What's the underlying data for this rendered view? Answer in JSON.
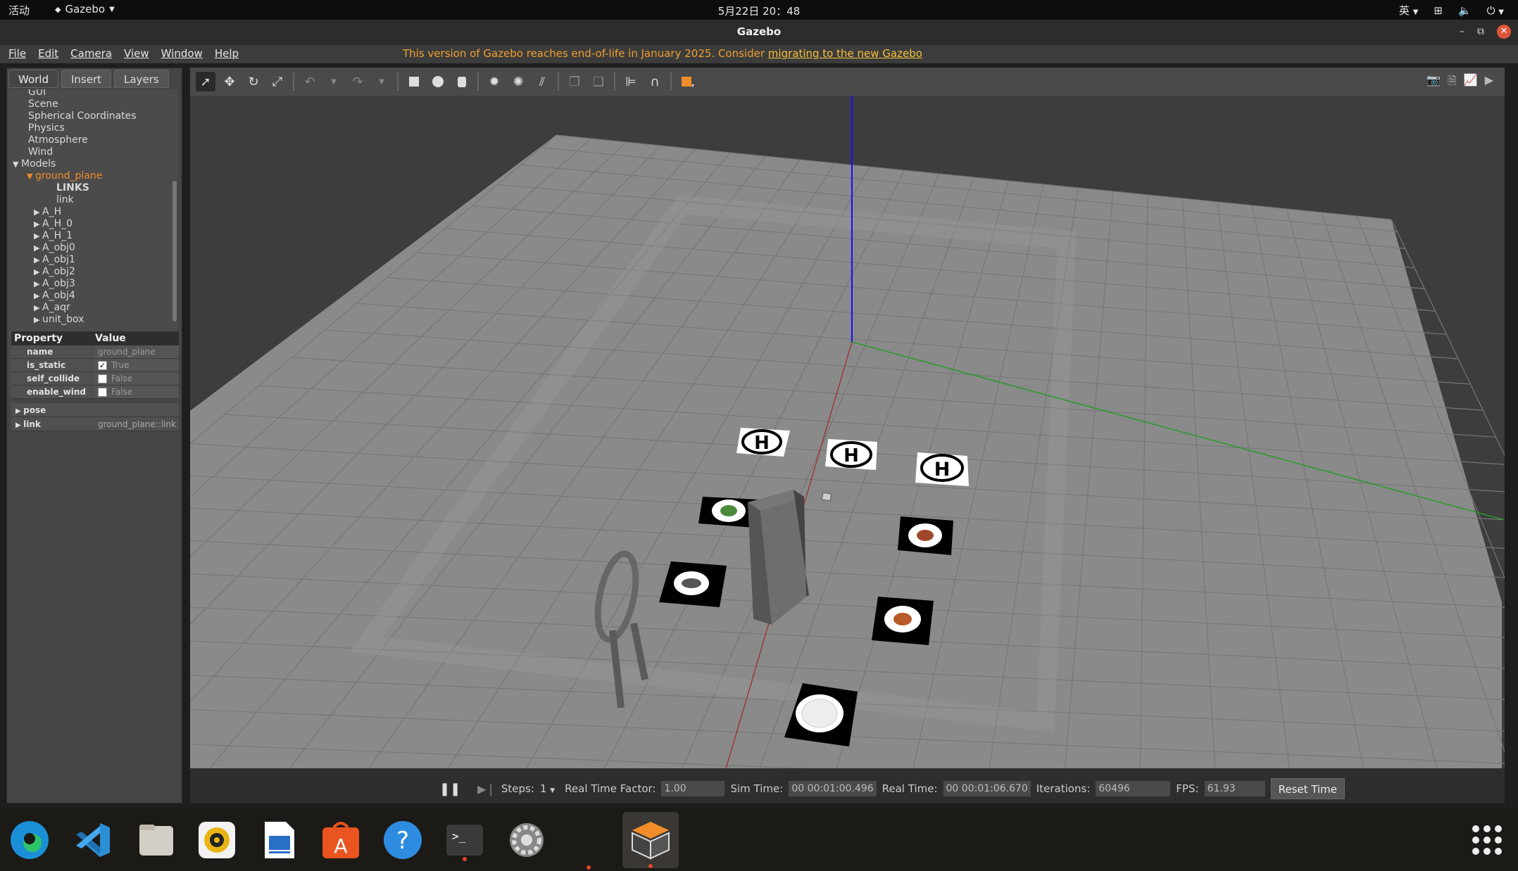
{
  "topbar": {
    "activities": "活动",
    "app_name": "Gazebo",
    "clock": "5月22日 20：48",
    "ime": "英"
  },
  "window": {
    "title": "Gazebo"
  },
  "menu": {
    "items": [
      "File",
      "Edit",
      "Camera",
      "View",
      "Window",
      "Help"
    ]
  },
  "notice": {
    "text": "This version of Gazebo reaches end-of-life in January 2025. Consider ",
    "link": "migrating to the new Gazebo"
  },
  "left_panel": {
    "tabs": [
      "World",
      "Insert",
      "Layers"
    ],
    "tree": {
      "top_items": [
        "GUI",
        "Scene",
        "Spherical Coordinates",
        "Physics",
        "Atmosphere",
        "Wind"
      ],
      "models_label": "Models",
      "selected": "ground_plane",
      "links_label": "LINKS",
      "link_label": "link",
      "models": [
        "A_H",
        "A_H_0",
        "A_H_1",
        "A_obj0",
        "A_obj1",
        "A_obj2",
        "A_obj3",
        "A_obj4",
        "A_aqr",
        "unit_box"
      ]
    },
    "properties": {
      "header_property": "Property",
      "header_value": "Value",
      "rows": [
        {
          "key": "name",
          "value": "ground_plane"
        },
        {
          "key": "is_static",
          "value": "True",
          "checked": true
        },
        {
          "key": "self_collide",
          "value": "False",
          "checked": false
        },
        {
          "key": "enable_wind",
          "value": "False",
          "checked": false
        }
      ],
      "pose_label": "pose",
      "link_label": "link",
      "link_value": "ground_plane::link"
    }
  },
  "status": {
    "steps_label": "Steps:",
    "steps_value": "1",
    "rtf_label": "Real Time Factor:",
    "rtf_value": "1.00",
    "sim_time_label": "Sim Time:",
    "sim_time_value": "00 00:01:00.496",
    "real_time_label": "Real Time:",
    "real_time_value": "00 00:01:06.670",
    "iterations_label": "Iterations:",
    "iterations_value": "60496",
    "fps_label": "FPS:",
    "fps_value": "61.93",
    "reset_label": "Reset Time"
  },
  "scene": {
    "h_marker_letter": "H"
  },
  "colors": {
    "accent": "#f08c2a",
    "eol": "#f0a030",
    "z_axis": "#1010ff",
    "y_axis": "#2a9a2a",
    "x_axis": "#9a3a3a",
    "ground": "#8a8a8a"
  }
}
